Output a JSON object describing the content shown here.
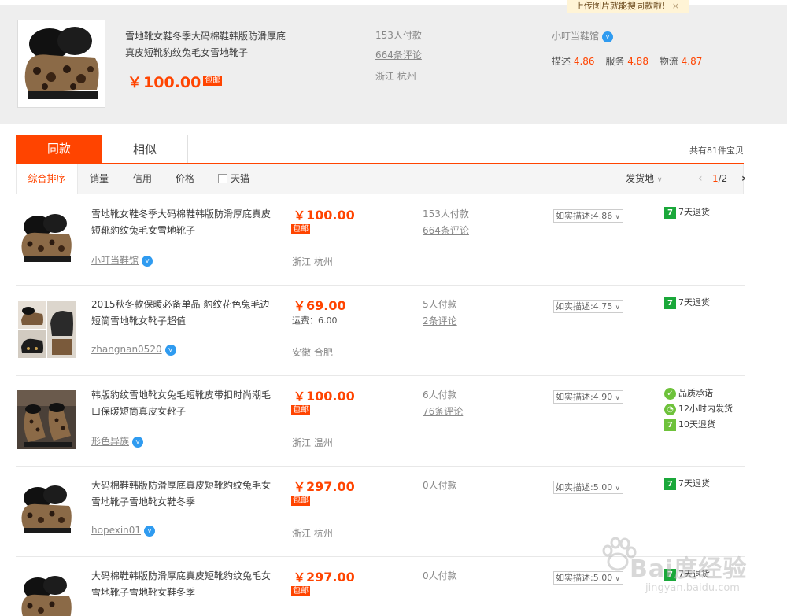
{
  "tooltip": {
    "text": "上传图片就能搜同款啦!",
    "close": "×"
  },
  "featured": {
    "title": "雪地靴女鞋冬季大码棉鞋韩版防滑厚底真皮短靴豹纹兔毛女雪地靴子",
    "price_symbol": "￥",
    "price": "100.00",
    "free_shipping": "包邮",
    "paid_count": "153人付款",
    "reviews": "664条评论",
    "location": "浙江 杭州",
    "shop": "小叮当鞋馆",
    "vip": "V",
    "scores": [
      {
        "label": "描述",
        "value": "4.86"
      },
      {
        "label": "服务",
        "value": "4.88"
      },
      {
        "label": "物流",
        "value": "4.87"
      }
    ]
  },
  "tabs": [
    {
      "label": "同款",
      "active": true
    },
    {
      "label": "相似",
      "active": false
    }
  ],
  "total_text": "共有81件宝贝",
  "sort": {
    "options": [
      "综合排序",
      "销量",
      "信用",
      "价格"
    ],
    "tmall_label": "天猫",
    "ship_from": "发货地",
    "page_current": "1",
    "page_total": "/2"
  },
  "items": [
    {
      "title": "雪地靴女鞋冬季大码棉鞋韩版防滑厚底真皮短靴豹纹兔毛女雪地靴子",
      "shop": "小叮当鞋馆",
      "price_symbol": "￥",
      "price": "100.00",
      "shipping": "包邮",
      "paid": "153人付款",
      "reviews": "664条评论",
      "location": "浙江 杭州",
      "desc": "如实描述:4.86",
      "services": [
        {
          "icon": "7",
          "label": "7天退货"
        }
      ]
    },
    {
      "title": "2015秋冬款保暖必备单品 豹纹花色兔毛边短筒雪地靴女靴子超值",
      "shop": "zhangnan0520",
      "price_symbol": "￥",
      "price": "69.00",
      "freight": "运费：6.00",
      "paid": "5人付款",
      "reviews": "2条评论",
      "location": "安徽 合肥",
      "desc": "如实描述:4.75",
      "services": [
        {
          "icon": "7",
          "label": "7天退货"
        }
      ]
    },
    {
      "title": "韩版豹纹雪地靴女兔毛短靴皮带扣时尚潮毛口保暖短筒真皮女靴子",
      "shop": "形色异族",
      "price_symbol": "￥",
      "price": "100.00",
      "shipping": "包邮",
      "paid": "6人付款",
      "reviews": "76条评论",
      "location": "浙江 温州",
      "desc": "如实描述:4.90",
      "services": [
        {
          "icon": "✓",
          "label": "品质承诺"
        },
        {
          "icon": "◔",
          "label": "12小时内发货"
        },
        {
          "icon": "7",
          "label": "10天退货"
        }
      ]
    },
    {
      "title": "大码棉鞋韩版防滑厚底真皮短靴豹纹兔毛女雪地靴子雪地靴女鞋冬季",
      "shop": "hopexin01",
      "price_symbol": "￥",
      "price": "297.00",
      "shipping": "包邮",
      "paid": "0人付款",
      "reviews": "",
      "location": "浙江 杭州",
      "desc": "如实描述:5.00",
      "services": [
        {
          "icon": "7",
          "label": "7天退货"
        }
      ]
    },
    {
      "title": "大码棉鞋韩版防滑厚底真皮短靴豹纹兔毛女雪地靴子雪地靴女鞋冬季",
      "shop": "",
      "price_symbol": "￥",
      "price": "297.00",
      "shipping": "包邮",
      "paid": "0人付款",
      "reviews": "",
      "location": "",
      "desc": "如实描述:5.00",
      "services": [
        {
          "icon": "7",
          "label": "7天退货"
        }
      ]
    }
  ],
  "watermark": {
    "text": "Bai度经验",
    "url": "jingyan.baidu.com"
  }
}
